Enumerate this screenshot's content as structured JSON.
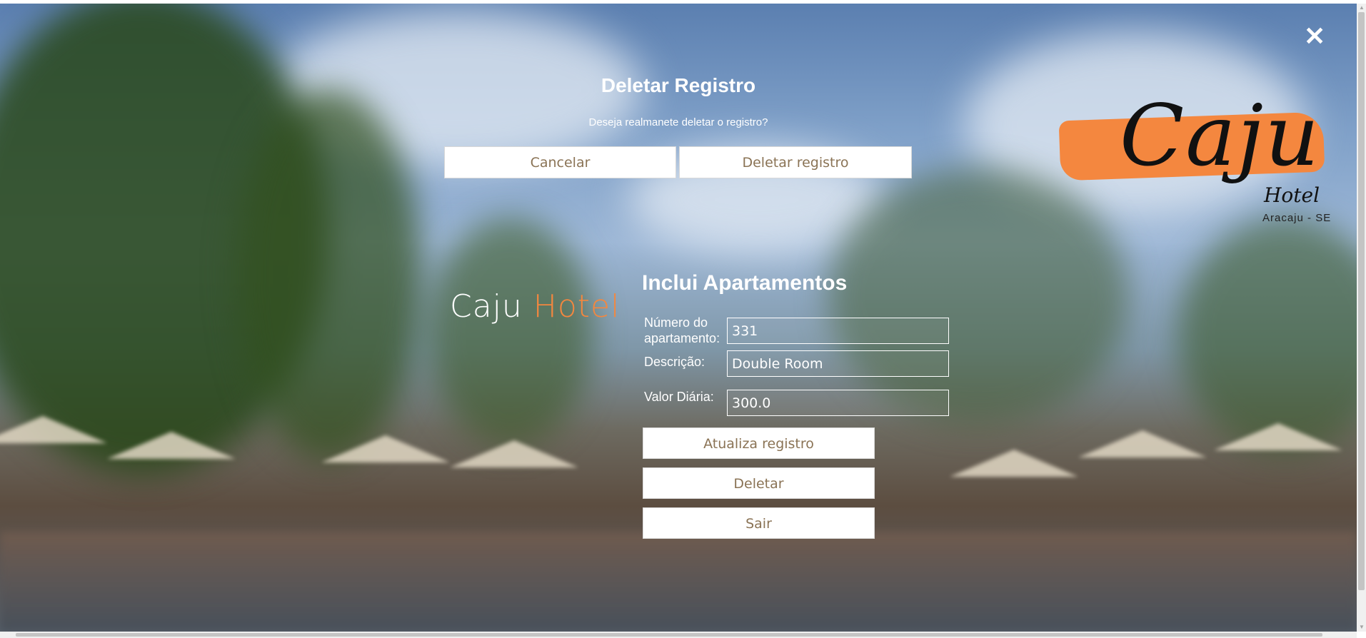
{
  "close_icon": "close-icon",
  "logo": {
    "word": "Caju",
    "sub": "Hotel",
    "location": "Aracaju - SE",
    "brush_color": "#f4873f"
  },
  "modal": {
    "title": "Deletar Registro",
    "message": "Deseja realmanete deletar o registro?",
    "cancel_label": "Cancelar",
    "delete_label": "Deletar registro"
  },
  "brand": {
    "first": "Caju",
    "second": "Hotel",
    "accent_color": "#f4873f"
  },
  "form": {
    "title": "Inclui Apartamentos",
    "number_label": "Número do apartamento:",
    "number_value": "331",
    "description_label": "Descrição:",
    "description_value": "Double Room",
    "daily_label": "Valor Diária:",
    "daily_value": "300.0",
    "update_label": "Atualiza registro",
    "delete_label": "Deletar",
    "exit_label": "Sair"
  },
  "colors": {
    "button_text": "#8a7355",
    "text": "#ffffff"
  }
}
